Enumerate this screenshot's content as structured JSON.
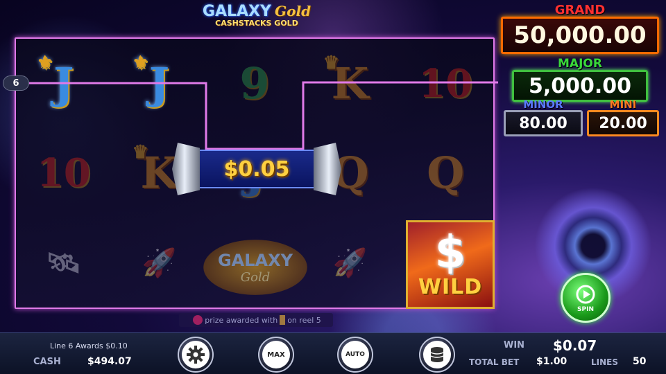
{
  "title": {
    "line1": "GALAXY",
    "line1_script": "Gold",
    "line2": "CASHSTACKS GOLD"
  },
  "jackpots": {
    "grand": {
      "label": "GRAND",
      "value": "50,000.00"
    },
    "major": {
      "label": "MAJOR",
      "value": "5,000.00"
    },
    "minor": {
      "label": "MINOR",
      "value": "80.00"
    },
    "mini": {
      "label": "MINI",
      "value": "20.00"
    }
  },
  "reels": {
    "row1": [
      {
        "symbol": "J",
        "icon": "fleur-de-lis-icon",
        "highlight": true
      },
      {
        "symbol": "J",
        "icon": "fleur-de-lis-icon",
        "highlight": true
      },
      {
        "symbol": "9",
        "icon": "",
        "highlight": false
      },
      {
        "symbol": "K",
        "icon": "crown-icon",
        "highlight": false
      },
      {
        "symbol": "10",
        "icon": "",
        "highlight": false
      }
    ],
    "row2": [
      {
        "symbol": "10",
        "highlight": false
      },
      {
        "symbol": "K",
        "icon": "crown-icon",
        "highlight": false
      },
      {
        "symbol": "J",
        "highlight": false
      },
      {
        "symbol": "Q",
        "icon": "rose-icon",
        "highlight": false
      },
      {
        "symbol": "Q",
        "icon": "rose-icon",
        "highlight": false
      }
    ],
    "row3": [
      {
        "symbol": "satellite",
        "highlight": false
      },
      {
        "symbol": "space-shuttle",
        "highlight": false
      },
      {
        "symbol": "galaxy-gold-logo",
        "highlight": false
      },
      {
        "symbol": "space-shuttle",
        "highlight": false
      },
      {
        "symbol": "wild",
        "highlight": true
      }
    ],
    "wild_symbol": {
      "dollar": "$",
      "text": "WILD"
    },
    "logo_symbol": {
      "line1": "GALAXY",
      "line2": "Gold"
    }
  },
  "payline": {
    "number": "6",
    "color": "#e07ae8"
  },
  "win_plaque": {
    "amount": "$0.05"
  },
  "info_strip": {
    "text_before": "prize awarded with",
    "text_after": "on reel 5"
  },
  "spin": {
    "label": "SPIN"
  },
  "bottom": {
    "award_text": "Line 6 Awards $0.10",
    "cash_label": "CASH",
    "cash_value": "$494.07",
    "max_label": "MAX",
    "auto_label": "AUTO",
    "win_label": "WIN",
    "win_value": "$0.07",
    "total_bet_label": "TOTAL BET",
    "total_bet_value": "$1.00",
    "lines_label": "LINES",
    "lines_value": "50"
  },
  "colors": {
    "grand": "#ff3030",
    "major": "#3ad83a",
    "minor": "#5a7aff",
    "mini": "#ff7a20",
    "spin": "#1a9a1a"
  }
}
